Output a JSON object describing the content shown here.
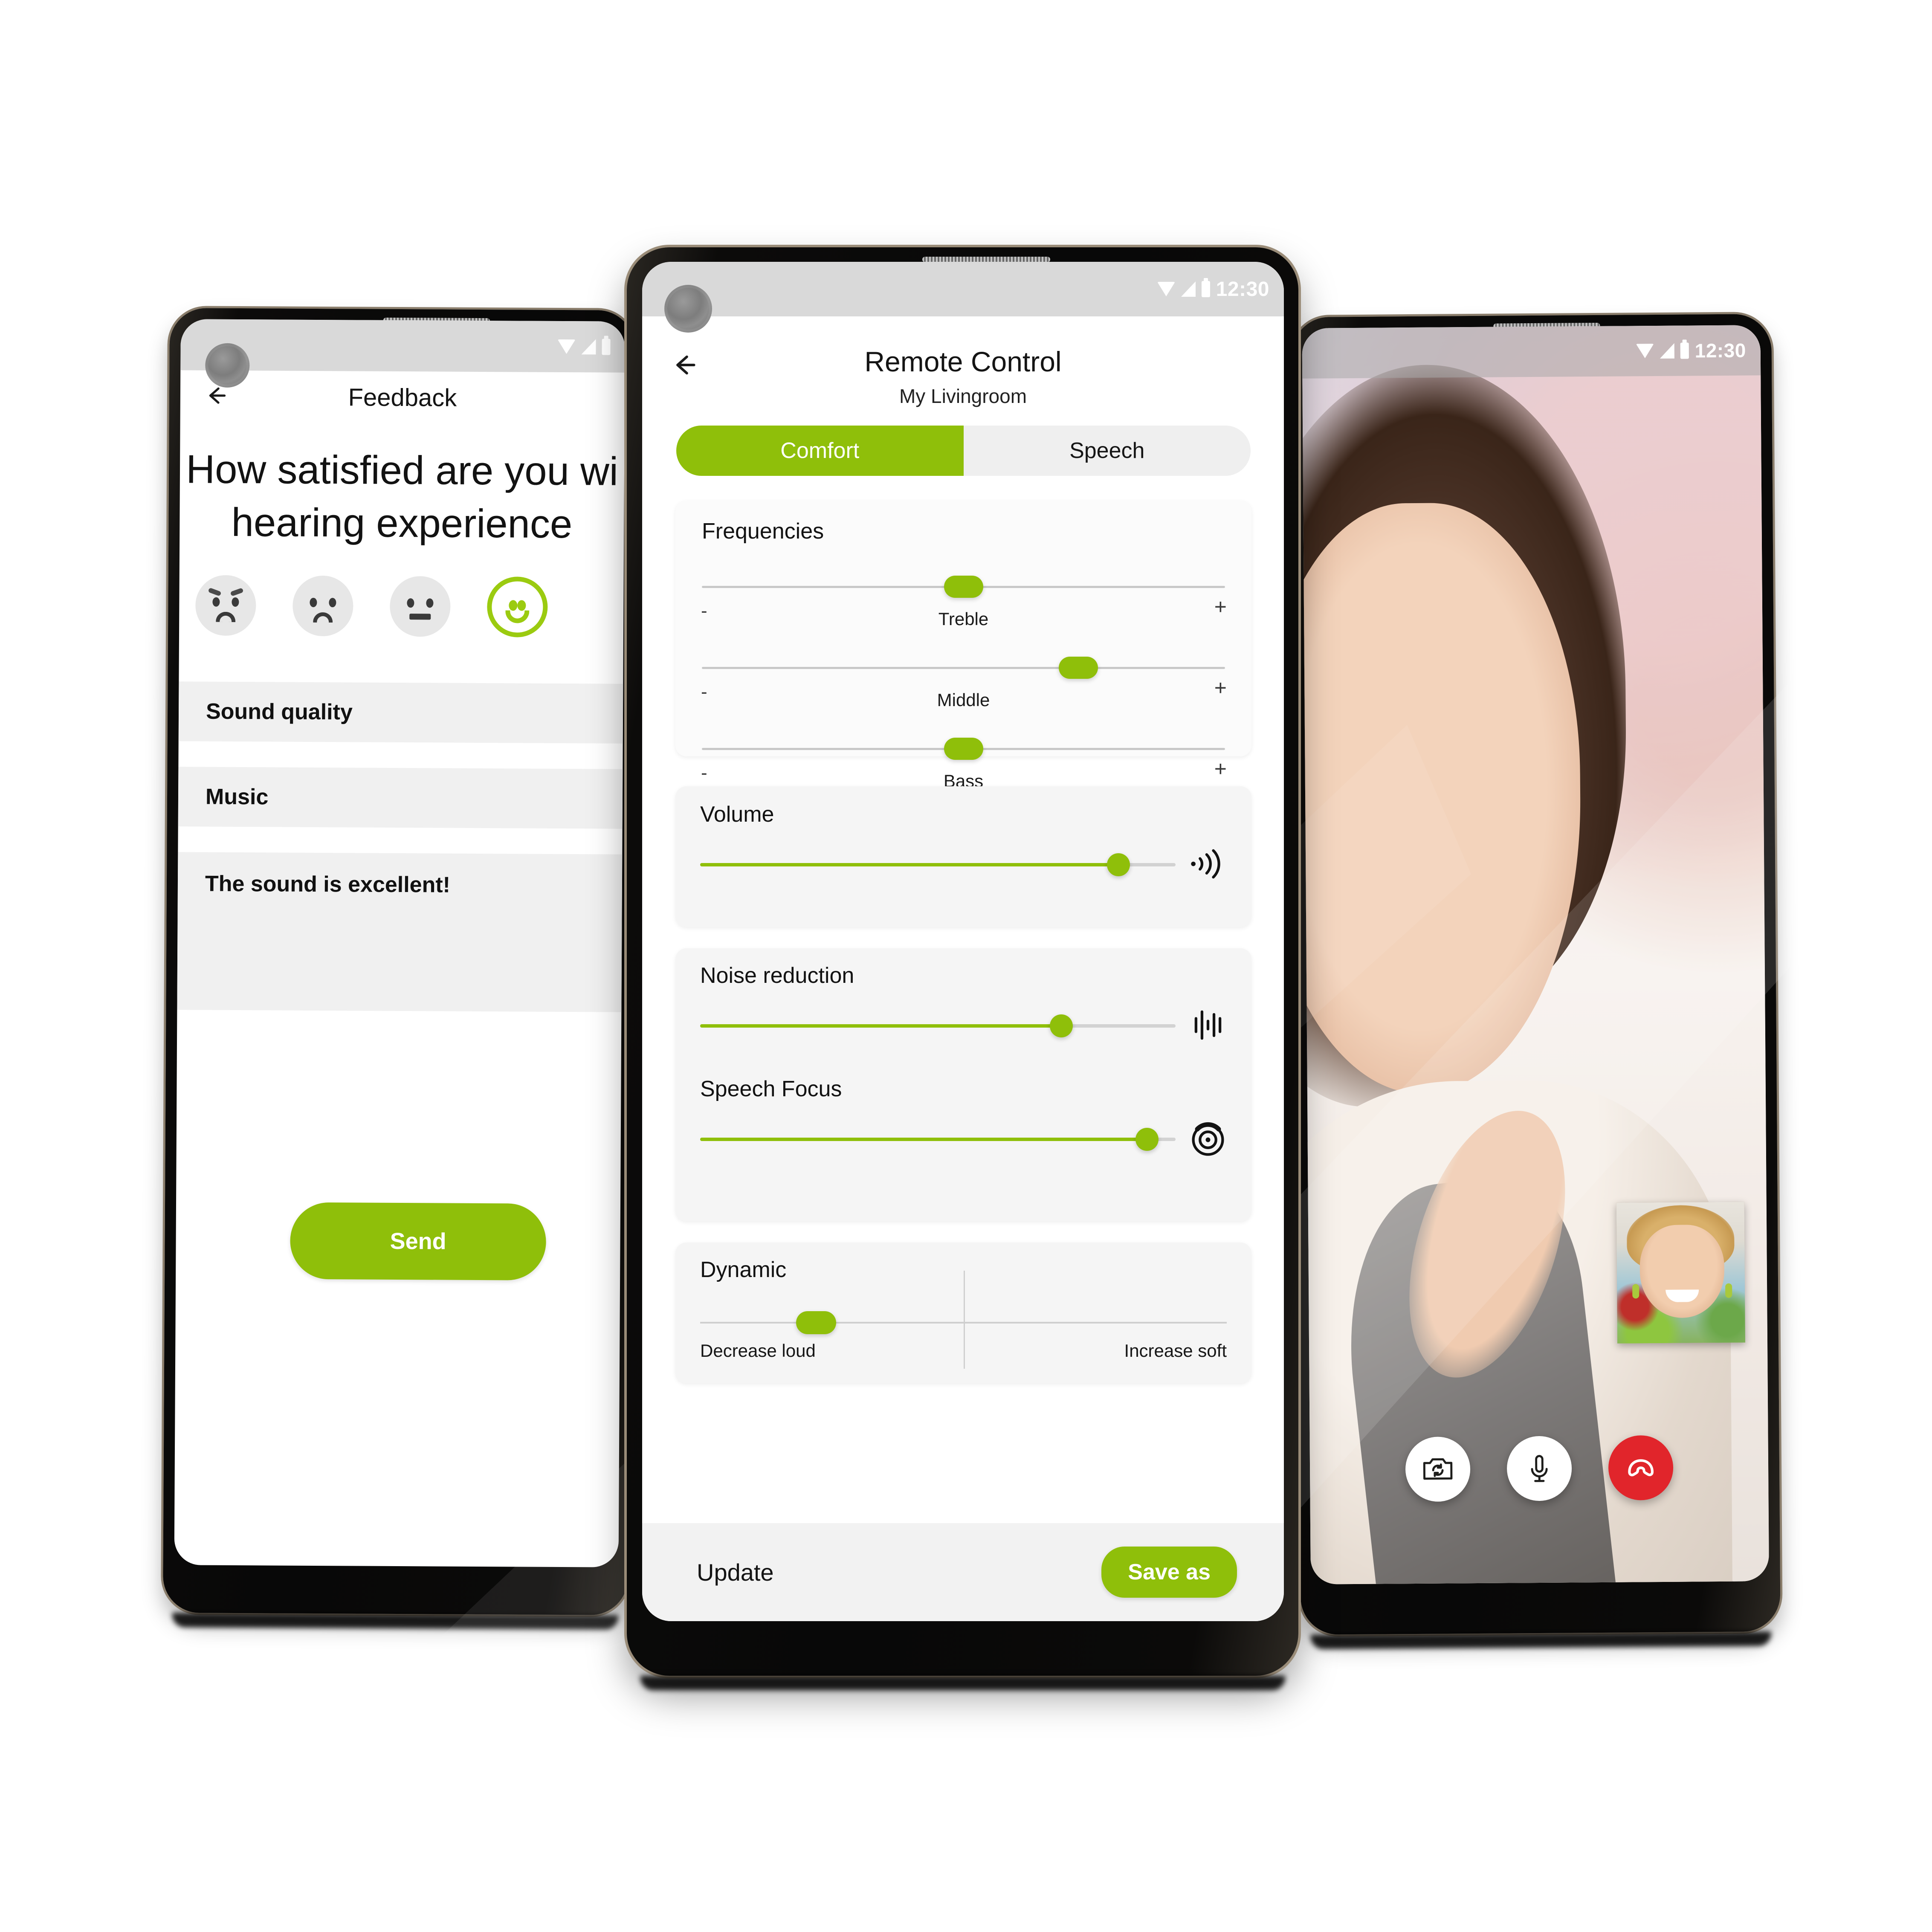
{
  "brand": {
    "green": "#8FBF0A",
    "red": "#E1252B",
    "grey": "#E7E7E7"
  },
  "left_phone": {
    "status": {
      "time": "",
      "wifi_icon": "wifi-icon",
      "signal_icon": "signal-icon",
      "battery_icon": "battery-icon"
    },
    "back_icon": "back-arrow-icon",
    "title": "Feedback",
    "question": [
      "How satisfied are you wi",
      "hearing experience"
    ],
    "faces": [
      {
        "name": "face-very-unsatisfied",
        "mood": "very-sad",
        "selected": false
      },
      {
        "name": "face-unsatisfied",
        "mood": "sad",
        "selected": false
      },
      {
        "name": "face-neutral",
        "mood": "neutral",
        "selected": false
      },
      {
        "name": "face-satisfied",
        "mood": "happy",
        "selected": true
      }
    ],
    "rows": [
      {
        "label": "Sound quality"
      },
      {
        "label": "Music"
      }
    ],
    "comment": "The sound is excellent!",
    "send_label": "Send"
  },
  "center_phone": {
    "status": {
      "time": "12:30",
      "wifi_icon": "wifi-icon",
      "signal_icon": "signal-icon",
      "battery_icon": "battery-icon"
    },
    "back_icon": "back-arrow-icon",
    "title": "Remote Control",
    "subtitle": "My Livingroom",
    "tabs": [
      {
        "label": "Comfort",
        "active": true
      },
      {
        "label": "Speech",
        "active": false
      }
    ],
    "frequencies": {
      "title": "Frequencies",
      "minus_label": "-",
      "plus_label": "+",
      "bands": [
        {
          "label": "Treble",
          "value_pct": 50
        },
        {
          "label": "Middle",
          "value_pct": 72
        },
        {
          "label": "Bass",
          "value_pct": 50
        }
      ]
    },
    "volume": {
      "title": "Volume",
      "value_pct": 88,
      "icon": "speaker-waves-icon"
    },
    "noise_reduction": {
      "title": "Noise reduction",
      "value_pct": 76,
      "icon": "audio-waveform-icon"
    },
    "speech_focus": {
      "title": "Speech Focus",
      "value_pct": 94,
      "icon": "target-focus-icon"
    },
    "dynamic": {
      "title": "Dynamic",
      "value_pct": 22,
      "left_label": "Decrease loud",
      "right_label": "Increase soft"
    },
    "footer": {
      "update_label": "Update",
      "save_as_label": "Save as"
    }
  },
  "right_phone": {
    "status": {
      "time": "12:30",
      "wifi_icon": "wifi-icon",
      "signal_icon": "signal-icon",
      "battery_icon": "battery-icon"
    },
    "remote_video": "video-call-remote-participant",
    "self_view": "video-call-self-view-thumbnail",
    "controls": [
      {
        "name": "switch-camera-button",
        "icon": "camera-flip-icon",
        "style": "white"
      },
      {
        "name": "mute-microphone-button",
        "icon": "microphone-icon",
        "style": "white"
      },
      {
        "name": "end-call-button",
        "icon": "end-call-icon",
        "style": "red"
      }
    ]
  }
}
